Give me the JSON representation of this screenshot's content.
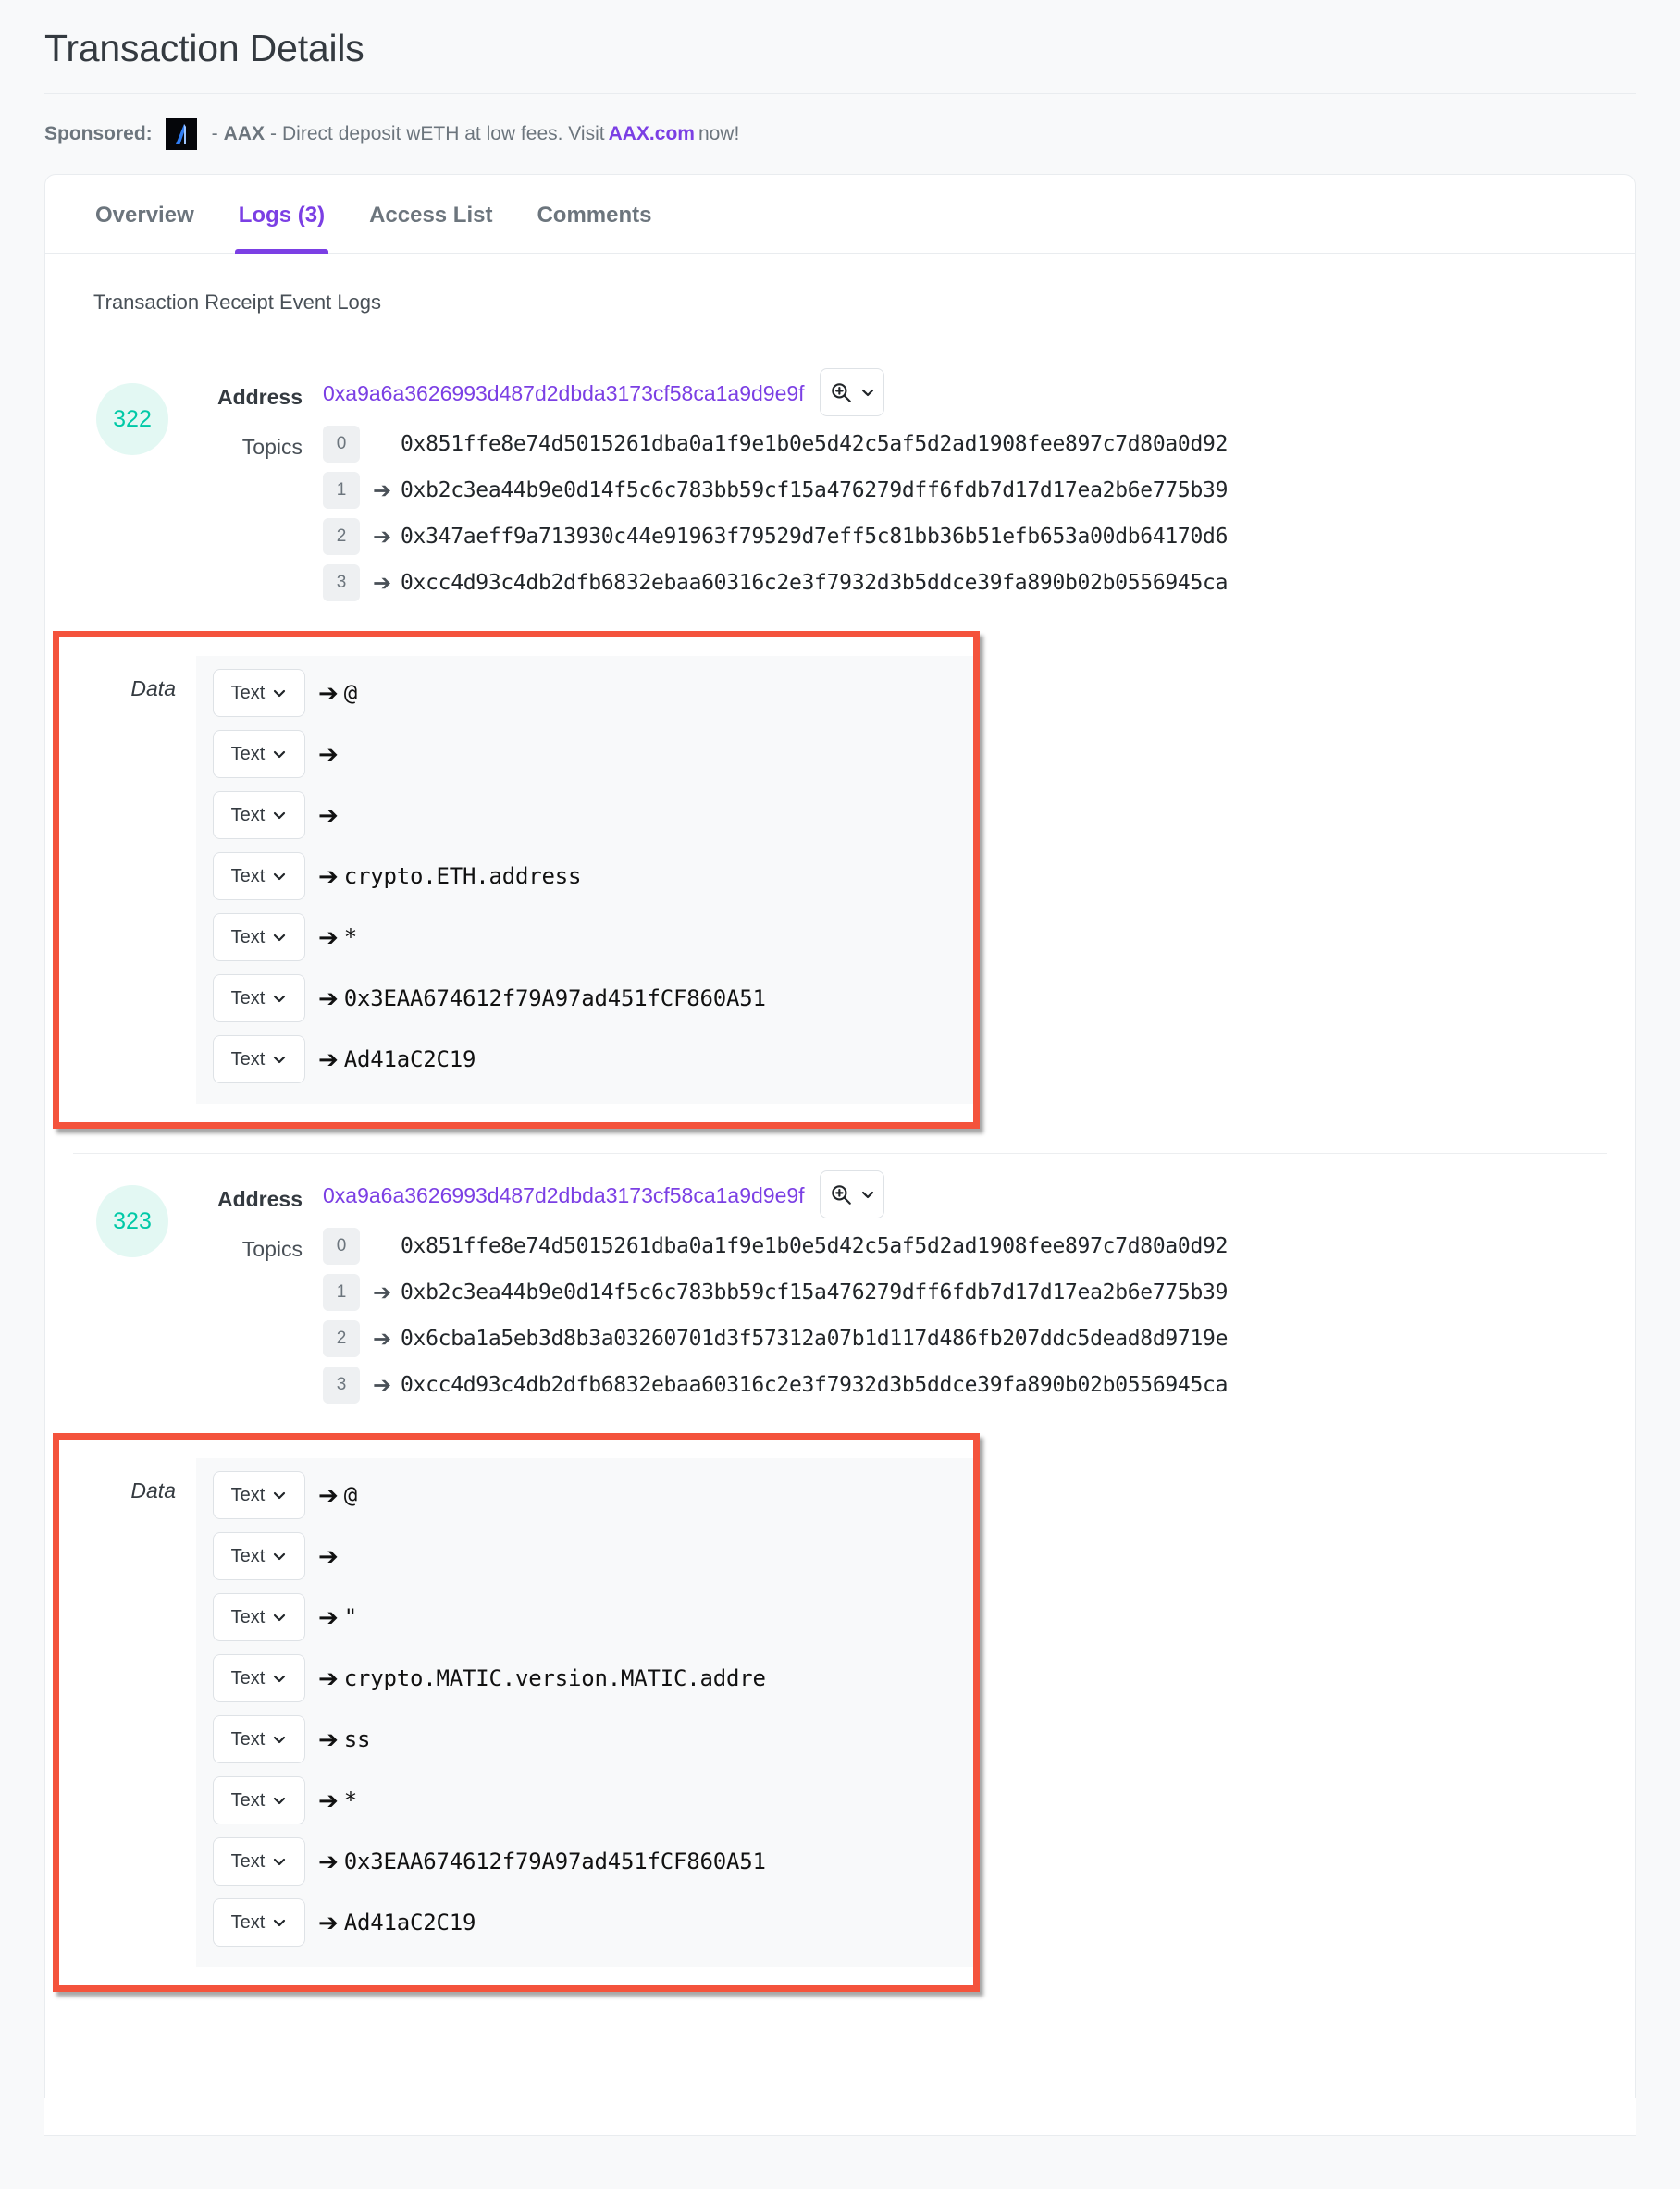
{
  "header": {
    "title": "Transaction Details"
  },
  "sponsored": {
    "label": "Sponsored:",
    "logo_alt": "aax-logo",
    "dash1": "-",
    "brand": "AAX",
    "dash2": "-",
    "text_before": "Direct deposit wETH at low fees. Visit",
    "link": "AAX.com",
    "text_after": "now!"
  },
  "tabs": [
    {
      "label": "Overview",
      "active": false
    },
    {
      "label": "Logs (3)",
      "active": true
    },
    {
      "label": "Access List",
      "active": false
    },
    {
      "label": "Comments",
      "active": false
    }
  ],
  "section_caption": "Transaction Receipt Event Logs",
  "labels": {
    "address": "Address",
    "topics": "Topics",
    "data": "Data",
    "text_select": "Text",
    "arrow": "➔"
  },
  "colors": {
    "accent": "#7b3fe4",
    "badge_text": "#00c9a7",
    "badge_bg": "#e3f8f3",
    "highlight": "#f4533c",
    "muted": "#6c757d"
  },
  "logs": [
    {
      "index": "322",
      "address": "0xa9a6a3626993d487d2dbda3173cf58ca1a9d9e9f",
      "topics": [
        {
          "idx": "0",
          "arrow": false,
          "value": "0x851ffe8e74d5015261dba0a1f9e1b0e5d42c5af5d2ad1908fee897c7d80a0d92"
        },
        {
          "idx": "1",
          "arrow": true,
          "value": "0xb2c3ea44b9e0d14f5c6c783bb59cf15a476279dff6fdb7d17d17ea2b6e775b39"
        },
        {
          "idx": "2",
          "arrow": true,
          "value": "0x347aeff9a713930c44e91963f79529d7eff5c81bb36b51efb653a00db64170d6"
        },
        {
          "idx": "3",
          "arrow": true,
          "value": "0xcc4d93c4db2dfb6832ebaa60316c2e3f7932d3b5ddce39fa890b02b0556945ca"
        }
      ],
      "data_rows": [
        {
          "select": "Text",
          "value": "@"
        },
        {
          "select": "Text",
          "value": ""
        },
        {
          "select": "Text",
          "value": ""
        },
        {
          "select": "Text",
          "value": "crypto.ETH.address"
        },
        {
          "select": "Text",
          "value": "*"
        },
        {
          "select": "Text",
          "value": "0x3EAA674612f79A97ad451fCF860A51"
        },
        {
          "select": "Text",
          "value": "Ad41aC2C19"
        }
      ]
    },
    {
      "index": "323",
      "address": "0xa9a6a3626993d487d2dbda3173cf58ca1a9d9e9f",
      "topics": [
        {
          "idx": "0",
          "arrow": false,
          "value": "0x851ffe8e74d5015261dba0a1f9e1b0e5d42c5af5d2ad1908fee897c7d80a0d92"
        },
        {
          "idx": "1",
          "arrow": true,
          "value": "0xb2c3ea44b9e0d14f5c6c783bb59cf15a476279dff6fdb7d17d17ea2b6e775b39"
        },
        {
          "idx": "2",
          "arrow": true,
          "value": "0x6cba1a5eb3d8b3a03260701d3f57312a07b1d117d486fb207ddc5dead8d9719e"
        },
        {
          "idx": "3",
          "arrow": true,
          "value": "0xcc4d93c4db2dfb6832ebaa60316c2e3f7932d3b5ddce39fa890b02b0556945ca"
        }
      ],
      "data_rows": [
        {
          "select": "Text",
          "value": "@"
        },
        {
          "select": "Text",
          "value": ""
        },
        {
          "select": "Text",
          "value": "\""
        },
        {
          "select": "Text",
          "value": "crypto.MATIC.version.MATIC.addre"
        },
        {
          "select": "Text",
          "value": "ss"
        },
        {
          "select": "Text",
          "value": "*"
        },
        {
          "select": "Text",
          "value": "0x3EAA674612f79A97ad451fCF860A51"
        },
        {
          "select": "Text",
          "value": "Ad41aC2C19"
        }
      ]
    }
  ]
}
